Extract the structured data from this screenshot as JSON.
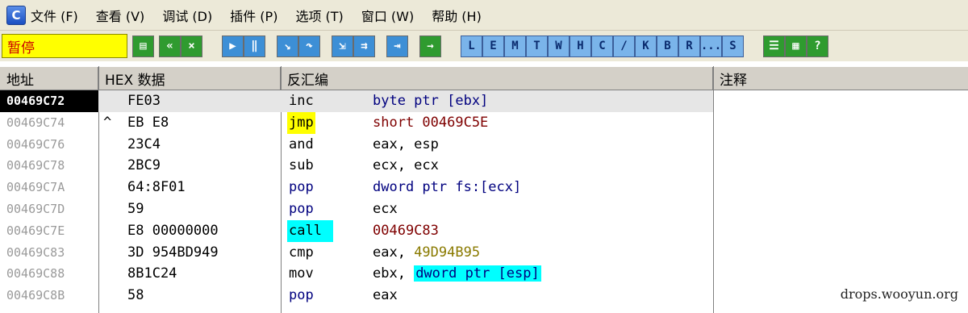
{
  "menu": {
    "app_icon_letter": "C",
    "items": [
      "文件 (F)",
      "查看 (V)",
      "调试 (D)",
      "插件 (P)",
      "选项 (T)",
      "窗口 (W)",
      "帮助 (H)"
    ]
  },
  "toolbar": {
    "status": "暂停",
    "letters": [
      "L",
      "E",
      "M",
      "T",
      "W",
      "H",
      "C",
      "/",
      "K",
      "B",
      "R",
      "...",
      "S"
    ]
  },
  "columns": {
    "address": "地址",
    "hex": "HEX 数据",
    "disasm": "反汇编",
    "comment": "注释"
  },
  "rows": [
    {
      "address": "00469C72",
      "marker": "",
      "hex": "FE03",
      "mnemonic": "inc",
      "operand1": "byte ptr [ebx]",
      "operand2": "",
      "selected": true
    },
    {
      "address": "00469C74",
      "marker": "^",
      "hex": "EB E8",
      "mnemonic": "jmp",
      "operand1": "short 00469C5E",
      "operand2": ""
    },
    {
      "address": "00469C76",
      "marker": "",
      "hex": "23C4",
      "mnemonic": "and",
      "operand1": "eax, esp",
      "operand2": ""
    },
    {
      "address": "00469C78",
      "marker": "",
      "hex": "2BC9",
      "mnemonic": "sub",
      "operand1": "ecx, ecx",
      "operand2": ""
    },
    {
      "address": "00469C7A",
      "marker": "",
      "hex": "64:8F01",
      "mnemonic": "pop",
      "operand1": "dword ptr fs:[ecx]",
      "operand2": ""
    },
    {
      "address": "00469C7D",
      "marker": "",
      "hex": "59",
      "mnemonic": "pop",
      "operand1": "ecx",
      "operand2": ""
    },
    {
      "address": "00469C7E",
      "marker": "",
      "hex": "E8 00000000",
      "mnemonic": "call",
      "operand1": "00469C83",
      "operand2": ""
    },
    {
      "address": "00469C83",
      "marker": "",
      "hex": "3D 954BD949",
      "mnemonic": "cmp",
      "operand1": "eax, ",
      "operand2": "49D94B95"
    },
    {
      "address": "00469C88",
      "marker": "",
      "hex": "8B1C24",
      "mnemonic": "mov",
      "operand1": "ebx, ",
      "operand2": "dword ptr [esp]"
    },
    {
      "address": "00469C8B",
      "marker": "",
      "hex": "58",
      "mnemonic": "pop",
      "operand1": "eax",
      "operand2": ""
    }
  ],
  "watermark": "drops.wooyun.org"
}
